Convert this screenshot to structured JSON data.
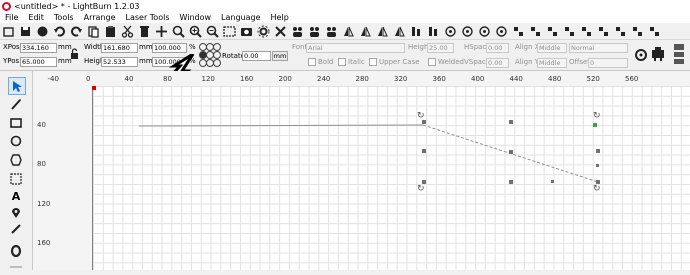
{
  "window": {
    "title": "<untitled> * - LightBurn 1.2.03"
  },
  "menu": [
    "File",
    "Edit",
    "Tools",
    "Arrange",
    "Laser Tools",
    "Window",
    "Language",
    "Help"
  ],
  "toolbar_icons": [
    "open-icon",
    "save-icon",
    "pan-icon",
    "undo-icon",
    "cut-icon",
    "copy-icon",
    "paste-icon",
    "scissors-icon",
    "delete-icon",
    "move-icon",
    "zoom-fit-icon",
    "zoom-in-icon",
    "zoom-out-icon",
    "frame-icon",
    "camera-icon",
    "settings-icon",
    "tools-icon",
    "group-icon",
    "ungroup-icon",
    "mirror-h-icon",
    "mirror-v-icon",
    "rotate-icon",
    "align-icon",
    "distribute-icon",
    "distribute-h-icon",
    "target-icon",
    "push-icon",
    "move-laser-icon",
    "boolean-icon",
    "weld-icon",
    "offset-icon",
    "array-icon",
    "dock-icon",
    "node-icon",
    "split-icon",
    "grid-icon",
    "snap-icon",
    "more-icon",
    "extra-icon"
  ],
  "position": {
    "xpos_label": "XPos",
    "xpos_value": "334.160",
    "ypos_label": "YPos",
    "ypos_value": "65.000",
    "unit": "mm"
  },
  "size": {
    "width_label": "Width",
    "width_value": "161.680",
    "height_label": "Height",
    "height_value": "52.533",
    "unit": "mm",
    "width_pct": "100.000",
    "height_pct": "100.000",
    "pct": "%"
  },
  "rotate": {
    "label": "Rotate",
    "value": "0.00",
    "unit_button": "mm"
  },
  "font": {
    "label": "Font",
    "value": "Arial",
    "height_label": "Height",
    "height_value": "25.00",
    "hspace_label": "HSpace",
    "hspace_value": "0.00",
    "alignx_label": "Align X",
    "alignx_value": "Middle",
    "style_value": "Normal",
    "vspace_label": "VSpace",
    "vspace_value": "0.00",
    "aligny_label": "Align Y",
    "aligny_value": "Middle",
    "offset_label": "Offset",
    "offset_value": "0"
  },
  "text_options": {
    "bold": "Bold",
    "italic": "Italic",
    "upper": "Upper Case",
    "welded": "Welded"
  },
  "ruler": {
    "x_ticks": [
      "-40",
      "0",
      "40",
      "80",
      "120",
      "160",
      "200",
      "240",
      "280",
      "320",
      "360",
      "400",
      "440",
      "480",
      "520",
      "560"
    ],
    "y_ticks": [
      "40",
      "80",
      "120",
      "160"
    ]
  },
  "rotate_glyph": "↻",
  "colors": {
    "accent": "#0a64c8",
    "selected_green": "#2fa84a"
  }
}
